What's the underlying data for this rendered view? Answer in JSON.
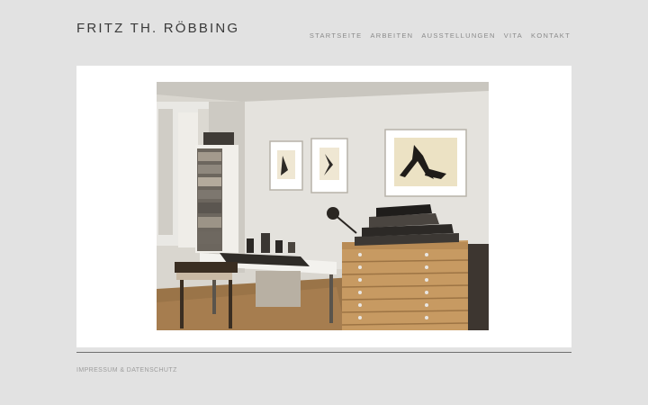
{
  "header": {
    "site_title": "FRITZ TH. RÖBBING"
  },
  "nav": {
    "items": [
      {
        "label": "STARTSEITE"
      },
      {
        "label": "ARBEITEN"
      },
      {
        "label": "AUSSTELLUNGEN"
      },
      {
        "label": "VITA"
      },
      {
        "label": "KONTAKT"
      }
    ]
  },
  "footer": {
    "link_label": "IMPRESSUM & DATENSCHUTZ"
  },
  "colors": {
    "page_background": "#e2e2e2",
    "card_background": "#ffffff",
    "title_text": "#3a3a3a",
    "nav_text": "#8a8a8a",
    "divider": "#6f6f6f"
  }
}
